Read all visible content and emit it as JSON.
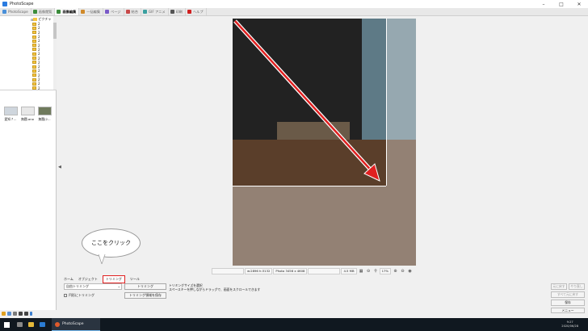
{
  "window": {
    "title": "PhotoScape"
  },
  "tabs": [
    {
      "label": "PhotoScape",
      "color": "#4a90d9"
    },
    {
      "label": "画像閲覧",
      "color": "#3c8c3c"
    },
    {
      "label": "画像編集",
      "color": "#3c8c3c",
      "active": true
    },
    {
      "label": "一括編集",
      "color": "#d08a2a"
    },
    {
      "label": "ページ",
      "color": "#7a5ac8"
    },
    {
      "label": "結合",
      "color": "#c84a4a"
    },
    {
      "label": "GIF アニメ",
      "color": "#3aa0a0"
    },
    {
      "label": "印刷",
      "color": "#555555"
    },
    {
      "label": "ヘルプ",
      "color": "#d02020"
    }
  ],
  "folder_tree": {
    "root_label": "ピクチャ",
    "items": [
      "2",
      "2",
      "2",
      "2",
      "2",
      "2",
      "2",
      "2",
      "2",
      "2",
      "2",
      "2",
      "2",
      "2",
      "2",
      "2"
    ]
  },
  "thumbnails": [
    {
      "label": "愛知７...",
      "color": "#cfd6dd"
    },
    {
      "label": "無題.ano",
      "color": "#e8e8e8"
    },
    {
      "label": "無題(2...",
      "color": "#6f7a5c"
    }
  ],
  "status": {
    "coords": "w:2896 h:3132",
    "photo_info": "Photo 3456 x 4608",
    "file_size": "4.5 MB",
    "zoom": "17%"
  },
  "callout": {
    "text": "ここをクリック"
  },
  "bottom": {
    "subtabs": [
      "ホーム",
      "オブジェクト",
      "トリミング",
      "ツール"
    ],
    "selected_subtab": "トリミング",
    "crop_mode": "自由トリミング",
    "crop_button": "トリミング",
    "save_crop_button": "トリミング領域を保存",
    "oval_crop": "円形にトリミング",
    "hint_line1": "トリミングサイズを選択",
    "hint_line2": "スペースキーを押しながらドラッグで、画面をスクロールできます",
    "undo": "元に戻す",
    "redo": "やり直し",
    "undo_all": "すべて元に戻す",
    "redo_all": "すべてやり直し",
    "save": "保存",
    "menu": "メニュー"
  },
  "taskbar": {
    "app_label": "PhotoScape",
    "time": "9:27",
    "date": "2020/06/28"
  },
  "colors": {
    "annotation_arrow": "#e02020",
    "callout_border": "#e02020"
  }
}
